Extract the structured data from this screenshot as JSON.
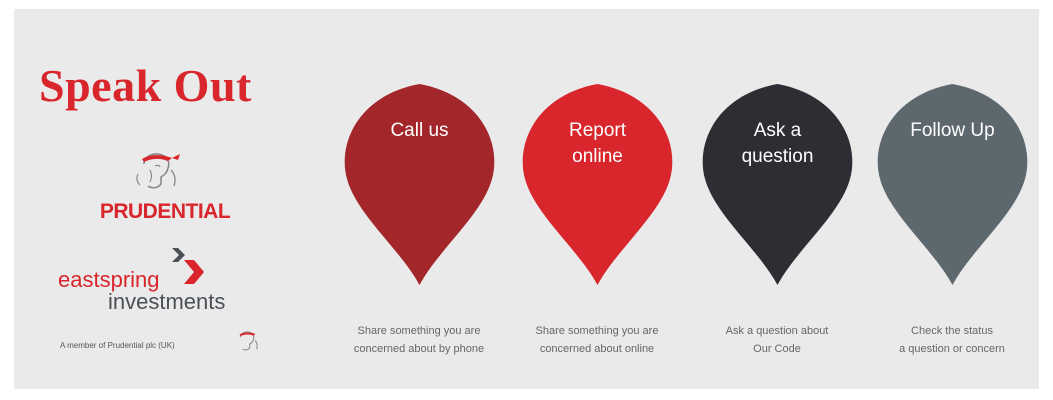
{
  "heading": "Speak Out",
  "logos": {
    "prudential": "PRUDENTIAL",
    "eastspring_line1": "eastspring",
    "eastspring_line2": "investments",
    "member_text": "A member of Prudential plc (UK)"
  },
  "pins": [
    {
      "label": "Call us",
      "caption": "Share something you are\nconcerned about by phone",
      "color": "#a3262a"
    },
    {
      "label": "Report\nonline",
      "caption": "Share something you are\nconcerned about online",
      "color": "#d8262c"
    },
    {
      "label": "Ask a\nquestion",
      "caption": "Ask a question about\nOur Code",
      "color": "#2c2e33"
    },
    {
      "label": "Follow Up",
      "caption": "Check the status\na question or concern",
      "color": "#5d676e"
    }
  ],
  "icons": {
    "prudential_emblem": "prudence-head-icon",
    "eastspring_mark": "chevron-right-icon"
  }
}
